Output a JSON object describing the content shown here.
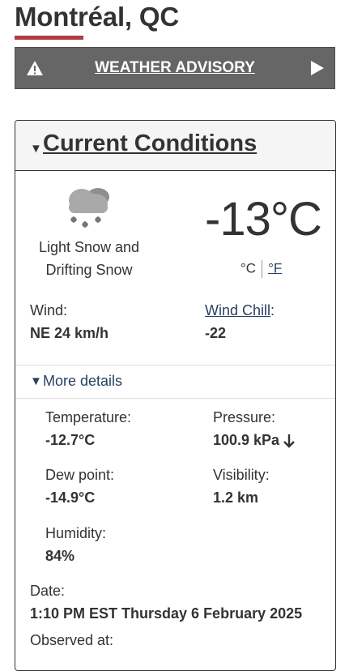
{
  "header": {
    "city": "Montréal, QC"
  },
  "advisory": {
    "label": "WEATHER ADVISORY",
    "warn_icon": "warning-triangle-icon",
    "arrow_icon": "play-arrow-icon"
  },
  "conditions": {
    "section_title": "Current Conditions",
    "icon": "light-snow-cloud-icon",
    "condition_line1": "Light Snow and",
    "condition_line2": "Drifting Snow",
    "temperature": "-13°C",
    "unit_c": "°C",
    "unit_f": "°F",
    "wind_label": "Wind:",
    "wind_value": "NE 24 km/h",
    "windchill_label": "Wind Chill",
    "windchill_colon": ":",
    "windchill_value": "-22"
  },
  "details": {
    "toggle_label": "More details",
    "temperature_label": "Temperature:",
    "temperature_value": "-12.7°C",
    "pressure_label": "Pressure:",
    "pressure_value": "100.9 kPa",
    "pressure_trend_icon": "arrow-down-icon",
    "dewpoint_label": "Dew point:",
    "dewpoint_value": "-14.9°C",
    "visibility_label": "Visibility:",
    "visibility_value": "1.2 km",
    "humidity_label": "Humidity:",
    "humidity_value": "84%"
  },
  "observation": {
    "date_label": "Date:",
    "date_value": "1:10 PM EST Thursday 6 February 2025",
    "observed_label": "Observed at:"
  },
  "colors": {
    "accent_red": "#af3c43",
    "advisory_bg": "#666666",
    "link_blue": "#284162"
  }
}
